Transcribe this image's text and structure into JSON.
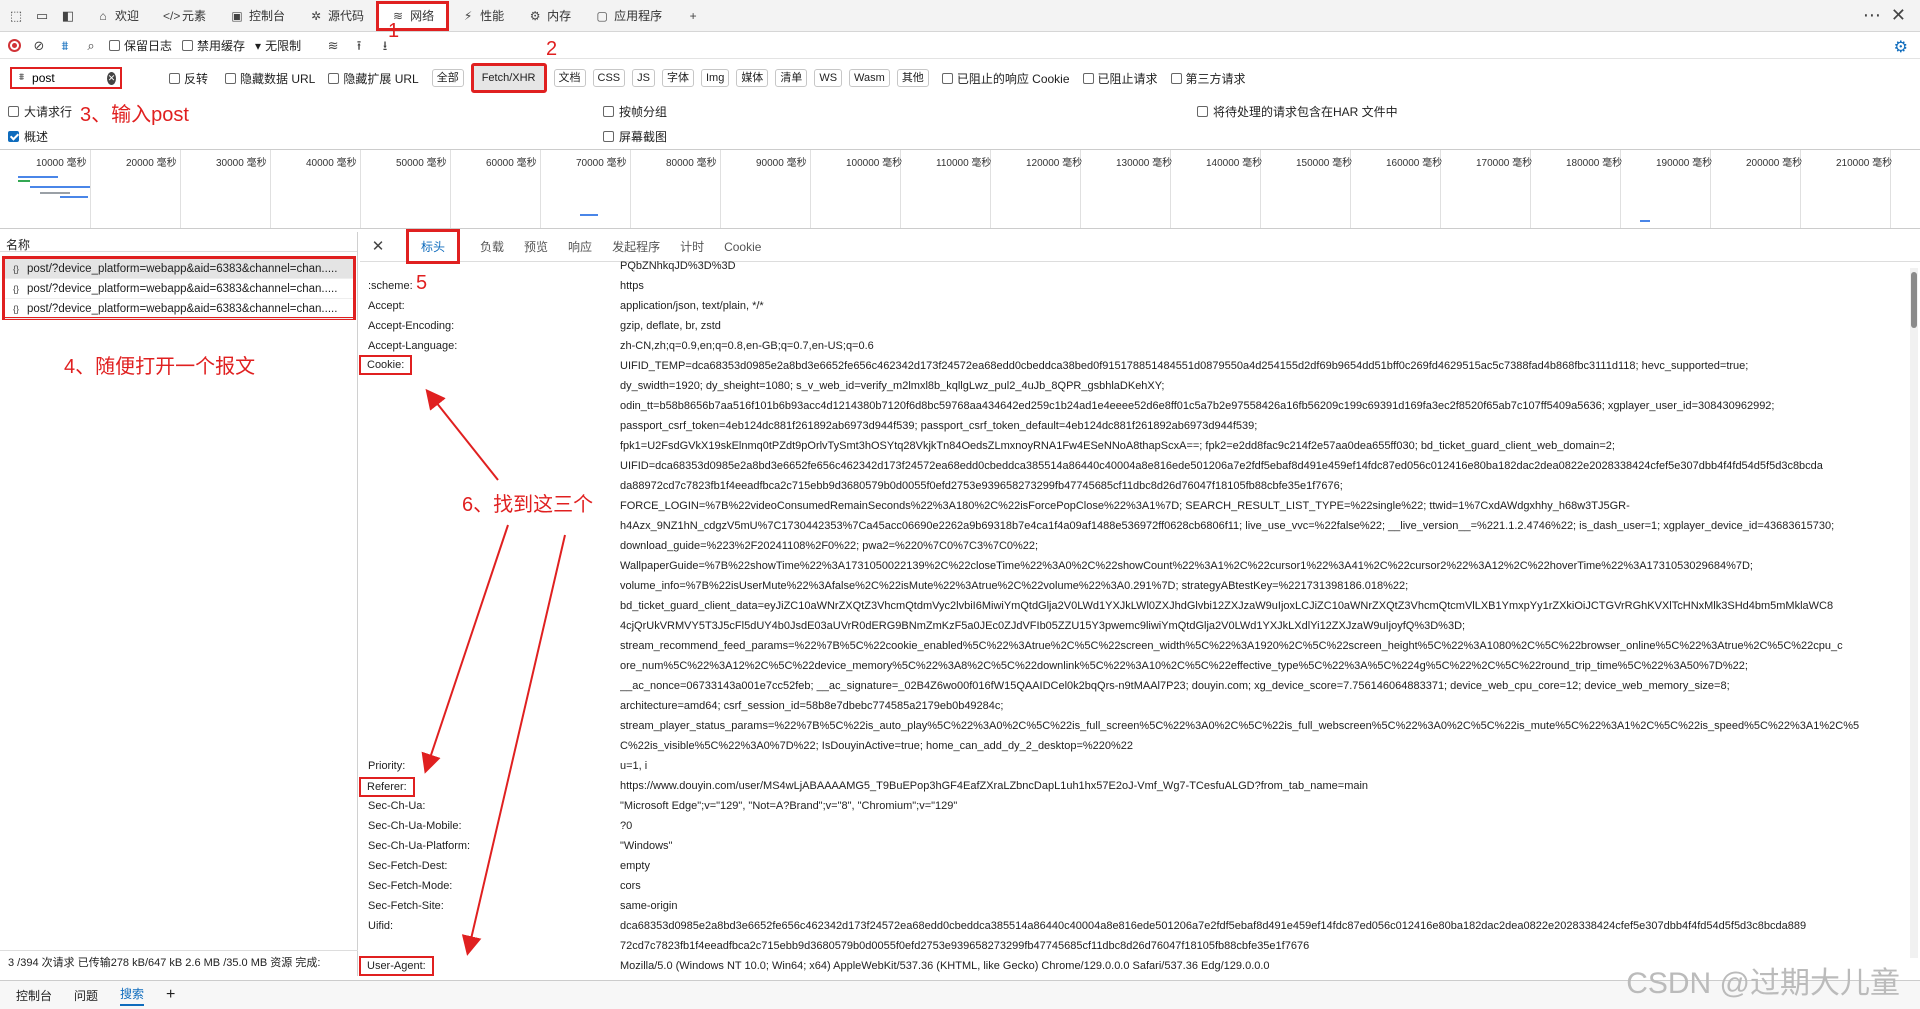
{
  "tabs": [
    {
      "label": "欢迎",
      "icon": "home-icon"
    },
    {
      "label": "元素",
      "icon": "code-icon"
    },
    {
      "label": "控制台",
      "icon": "console-icon"
    },
    {
      "label": "源代码",
      "icon": "bug-icon"
    },
    {
      "label": "网络",
      "icon": "wifi-icon",
      "active": true
    },
    {
      "label": "性能",
      "icon": "performance-icon"
    },
    {
      "label": "内存",
      "icon": "memory-icon"
    },
    {
      "label": "应用程序",
      "icon": "app-icon"
    }
  ],
  "toolbar": {
    "preserve_log": "保留日志",
    "disable_cache": "禁用缓存",
    "throttle": "无限制"
  },
  "filter": {
    "value": "post",
    "invert": "反转",
    "hide_data_url": "隐藏数据 URL",
    "hide_ext_url": "隐藏扩展 URL"
  },
  "type_chips": [
    "全部",
    "Fetch/XHR",
    "文档",
    "CSS",
    "JS",
    "字体",
    "Img",
    "媒体",
    "清单",
    "WS",
    "Wasm",
    "其他"
  ],
  "filter_extra": {
    "blocked_cookie": "已阻止的响应 Cookie",
    "blocked_requests": "已阻止请求",
    "third_party": "第三方请求"
  },
  "options": {
    "big_rows": "大请求行",
    "group_by_frame": "按帧分组",
    "har": "将待处理的请求包含在HAR 文件中",
    "overview": "概述",
    "screenshots": "屏幕截图"
  },
  "timeline_ticks": [
    "10000 毫秒",
    "20000 毫秒",
    "30000 毫秒",
    "40000 毫秒",
    "50000 毫秒",
    "60000 毫秒",
    "70000 毫秒",
    "80000 毫秒",
    "90000 毫秒",
    "100000 毫秒",
    "110000 毫秒",
    "120000 毫秒",
    "130000 毫秒",
    "140000 毫秒",
    "150000 毫秒",
    "160000 毫秒",
    "170000 毫秒",
    "180000 毫秒",
    "190000 毫秒",
    "200000 毫秒",
    "210000 毫秒"
  ],
  "left": {
    "name_header": "名称",
    "requests": [
      "post/?device_platform=webapp&aid=6383&channel=chan.....",
      "post/?device_platform=webapp&aid=6383&channel=chan.....",
      "post/?device_platform=webapp&aid=6383&channel=chan....."
    ],
    "status": "3 /394 次请求  已传输278 kB/647 kB  2.6 MB /35.0 MB 资源  完成:"
  },
  "detail_tabs": [
    "标头",
    "负载",
    "预览",
    "响应",
    "发起程序",
    "计时",
    "Cookie"
  ],
  "headers": {
    "top_fragment": "PQbZNhkqJD%3D%3D",
    "scheme_k": ":scheme:",
    "scheme_v": "https",
    "accept_k": "Accept:",
    "accept_v": "application/json, text/plain, */*",
    "encoding_k": "Accept-Encoding:",
    "encoding_v": "gzip, deflate, br, zstd",
    "language_k": "Accept-Language:",
    "language_v": "zh-CN,zh;q=0.9,en;q=0.8,en-GB;q=0.7,en-US;q=0.6",
    "cookie_k": "Cookie:",
    "cookie_lines": [
      "UIFID_TEMP=dca68353d0985e2a8bd3e6652fe656c462342d173f24572ea68edd0cbeddca38bed0f915178851484551d0879550a4d254155d2df69b9654dd51bff0c269fd4629515ac5c7388fad4b868fbc3111d118; hevc_supported=true;",
      "dy_swidth=1920; dy_sheight=1080; s_v_web_id=verify_m2lmxl8b_kqllgLwz_pul2_4uJb_8QPR_gsbhlaDKehXY;",
      "odin_tt=b58b8656b7aa516f101b6b93acc4d1214380b7120f6d8bc59768aa434642ed259c1b24ad1e4eeee52d6e8ff01c5a7b2e97558426a16fb56209c199c69391d169fa3ec2f8520f65ab7c107ff5409a5636; xgplayer_user_id=308430962992;",
      "passport_csrf_token=4eb124dc881f261892ab6973d944f539; passport_csrf_token_default=4eb124dc881f261892ab6973d944f539;",
      "fpk1=U2FsdGVkX19skElnmq0tPZdt9pOrlvTySmt3hOSYtq28VkjkTn84OedsZLmxnoyRNA1Fw4ESeNNoA8thapScxA==; fpk2=e2dd8fac9c214f2e57aa0dea655ff030; bd_ticket_guard_client_web_domain=2;",
      "UIFID=dca68353d0985e2a8bd3e6652fe656c462342d173f24572ea68edd0cbeddca385514a86440c40004a8e816ede501206a7e2fdf5ebaf8d491e459ef14fdc87ed056c012416e80ba182dac2dea0822e2028338424cfef5e307dbb4f4fd54d5f5d3c8bcda",
      "da88972cd7c7823fb1f4eeadfbca2c715ebb9d3680579b0d0055f0efd2753e939658273299fb47745685cf11dbc8d26d76047f18105fb88cbfe35e1f7676;",
      "FORCE_LOGIN=%7B%22videoConsumedRemainSeconds%22%3A180%2C%22isForcePopClose%22%3A1%7D; SEARCH_RESULT_LIST_TYPE=%22single%22; ttwid=1%7CxdAWdgxhhy_h68w3TJ5GR-",
      "h4Azx_9NZ1hN_cdgzV5mU%7C1730442353%7Ca45acc06690e2262a9b69318b7e4ca1f4a09af1488e536972ff0628cb6806f11; live_use_vvc=%22false%22; __live_version__=%221.1.2.4746%22; is_dash_user=1; xgplayer_device_id=43683615730;",
      "download_guide=%223%2F20241108%2F0%22; pwa2=%220%7C0%7C3%7C0%22;",
      "WallpaperGuide=%7B%22showTime%22%3A1731050022139%2C%22closeTime%22%3A0%2C%22showCount%22%3A1%2C%22cursor1%22%3A41%2C%22cursor2%22%3A12%2C%22hoverTime%22%3A1731053029684%7D;",
      "volume_info=%7B%22isUserMute%22%3Afalse%2C%22isMute%22%3Atrue%2C%22volume%22%3A0.291%7D; strategyABtestKey=%221731398186.018%22;",
      "bd_ticket_guard_client_data=eyJiZC10aWNrZXQtZ3VhcmQtdmVyc2lvbiI6MiwiYmQtdGlja2V0LWd1YXJkLWl0ZXJhdGlvbi12ZXJzaW9uIjoxLCJiZC10aWNrZXQtZ3VhcmQtcmVlLXB1YmxpYy1rZXkiOiJCTGVrRGhKVXlTcHNxMlk3SHd4bm5mMklaWC8",
      "4cjQrUkVRMVY5T3J5cFl5dUY4b0JsdE03aUVrR0dERG9BNmZmKzF5a0JEc0ZJdVFIb05ZZU15Y3pwemc9liwiYmQtdGlja2V0LWd1YXJkLXdlYi12ZXJzaW9uIjoyfQ%3D%3D;",
      "stream_recommend_feed_params=%22%7B%5C%22cookie_enabled%5C%22%3Atrue%2C%5C%22screen_width%5C%22%3A1920%2C%5C%22screen_height%5C%22%3A1080%2C%5C%22browser_online%5C%22%3Atrue%2C%5C%22cpu_c",
      "ore_num%5C%22%3A12%2C%5C%22device_memory%5C%22%3A8%2C%5C%22downlink%5C%22%3A10%2C%5C%22effective_type%5C%22%3A%5C%224g%5C%22%2C%5C%22round_trip_time%5C%22%3A50%7D%22;",
      "__ac_nonce=06733143a001e7cc52feb; __ac_signature=_02B4Z6wo00f016fW15QAAIDCel0k2bqQrs-n9tMAAl7P23; douyin.com; xg_device_score=7.756146064883371; device_web_cpu_core=12; device_web_memory_size=8;",
      "architecture=amd64; csrf_session_id=58b8e7dbebc774585a2179eb0b49284c;",
      "stream_player_status_params=%22%7B%5C%22is_auto_play%5C%22%3A0%2C%5C%22is_full_screen%5C%22%3A0%2C%5C%22is_full_webscreen%5C%22%3A0%2C%5C%22is_mute%5C%22%3A1%2C%5C%22is_speed%5C%22%3A1%2C%5",
      "C%22is_visible%5C%22%3A0%7D%22; IsDouyinActive=true; home_can_add_dy_2_desktop=%220%22"
    ],
    "priority_k": "Priority:",
    "priority_v": "u=1, i",
    "referer_k": "Referer:",
    "referer_v": "https://www.douyin.com/user/MS4wLjABAAAAMG5_T9BuEPop3hGF4EafZXraLZbncDapL1uh1hx57E2oJ-Vmf_Wg7-TCesfuALGD?from_tab_name=main",
    "secchua_k": "Sec-Ch-Ua:",
    "secchua_v": "\"Microsoft Edge\";v=\"129\", \"Not=A?Brand\";v=\"8\", \"Chromium\";v=\"129\"",
    "mobile_k": "Sec-Ch-Ua-Mobile:",
    "mobile_v": "?0",
    "platform_k": "Sec-Ch-Ua-Platform:",
    "platform_v": "\"Windows\"",
    "dest_k": "Sec-Fetch-Dest:",
    "dest_v": "empty",
    "mode_k": "Sec-Fetch-Mode:",
    "mode_v": "cors",
    "site_k": "Sec-Fetch-Site:",
    "site_v": "same-origin",
    "uifid_k": "Uifid:",
    "uifid_lines": [
      "dca68353d0985e2a8bd3e6652fe656c462342d173f24572ea68edd0cbeddca385514a86440c40004a8e816ede501206a7e2fdf5ebaf8d491e459ef14fdc87ed056c012416e80ba182dac2dea0822e2028338424cfef5e307dbb4f4fd54d5f5d3c8bcda889",
      "72cd7c7823fb1f4eeadfbca2c715ebb9d3680579b0d0055f0efd2753e939658273299fb47745685cf11dbc8d26d76047f18105fb88cbfe35e1f7676"
    ],
    "ua_k": "User-Agent:",
    "ua_v": "Mozilla/5.0 (Windows NT 10.0; Win64; x64) AppleWebKit/537.36 (KHTML, like Gecko) Chrome/129.0.0.0 Safari/537.36 Edg/129.0.0.0"
  },
  "annotations": {
    "n1": "1",
    "n2": "2",
    "n3": "3、输入post",
    "n4": "4、随便打开一个报文",
    "n5": "5",
    "n6": "6、找到这三个"
  },
  "drawer": [
    "控制台",
    "问题",
    "搜索"
  ],
  "watermark": "CSDN @过期大儿童",
  "colors": {
    "annotation": "#e02020",
    "accent": "#0f6cbd"
  }
}
